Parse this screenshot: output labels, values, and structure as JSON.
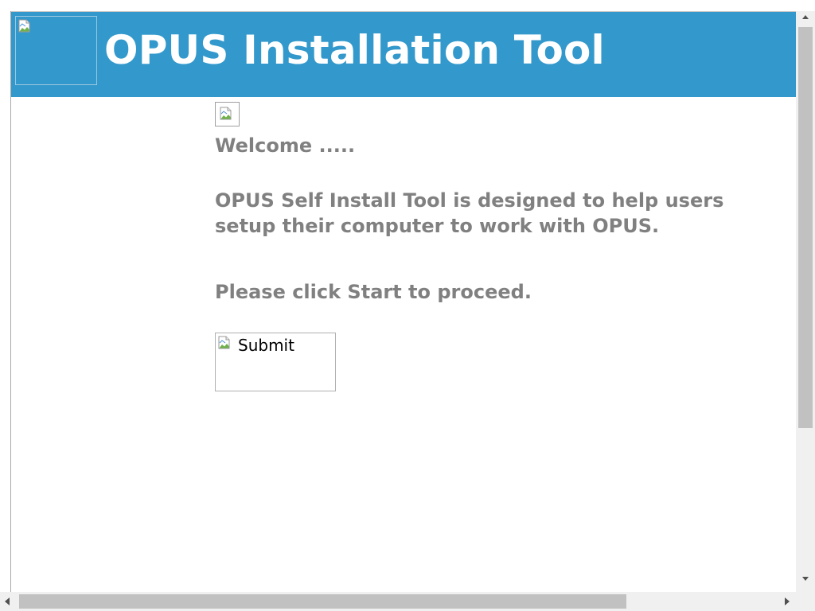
{
  "header": {
    "title": "OPUS Installation Tool",
    "logo_icon": "broken-image-icon",
    "background_color": "#3399cc"
  },
  "content": {
    "welcome": "Welcome .....",
    "description_line1": "OPUS Self Install Tool is designed to help users",
    "description_line2": "setup their computer to work with OPUS.",
    "instruction": "Please click Start to proceed.",
    "submit_alt": "Submit",
    "text_color": "#808080"
  },
  "scrollbars": {
    "vertical": "visible",
    "horizontal": "visible"
  }
}
